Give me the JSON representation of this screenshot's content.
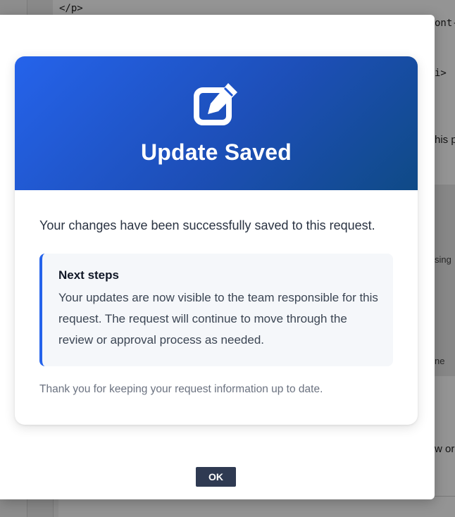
{
  "background": {
    "code_lines": [
      "</p>",
      "ont-s",
      "i>",
      "his p"
    ],
    "side_snippets": [
      "sing",
      "ne",
      "w or"
    ]
  },
  "dialog": {
    "card": {
      "icon": "edit-square-icon",
      "title": "Update Saved",
      "message": "Your changes have been successfully saved to this request.",
      "next_steps": {
        "title": "Next steps",
        "body": "Your updates are now visible to the team responsible for this request. The request will continue to move through the review or approval process as needed."
      },
      "thanks": "Thank you for keeping your request information up to date."
    },
    "ok_label": "OK"
  },
  "colors": {
    "header_gradient_start": "#2563eb",
    "header_gradient_end": "#0f4a86",
    "accent_border": "#2563eb",
    "ok_button": "#2f3a52"
  }
}
